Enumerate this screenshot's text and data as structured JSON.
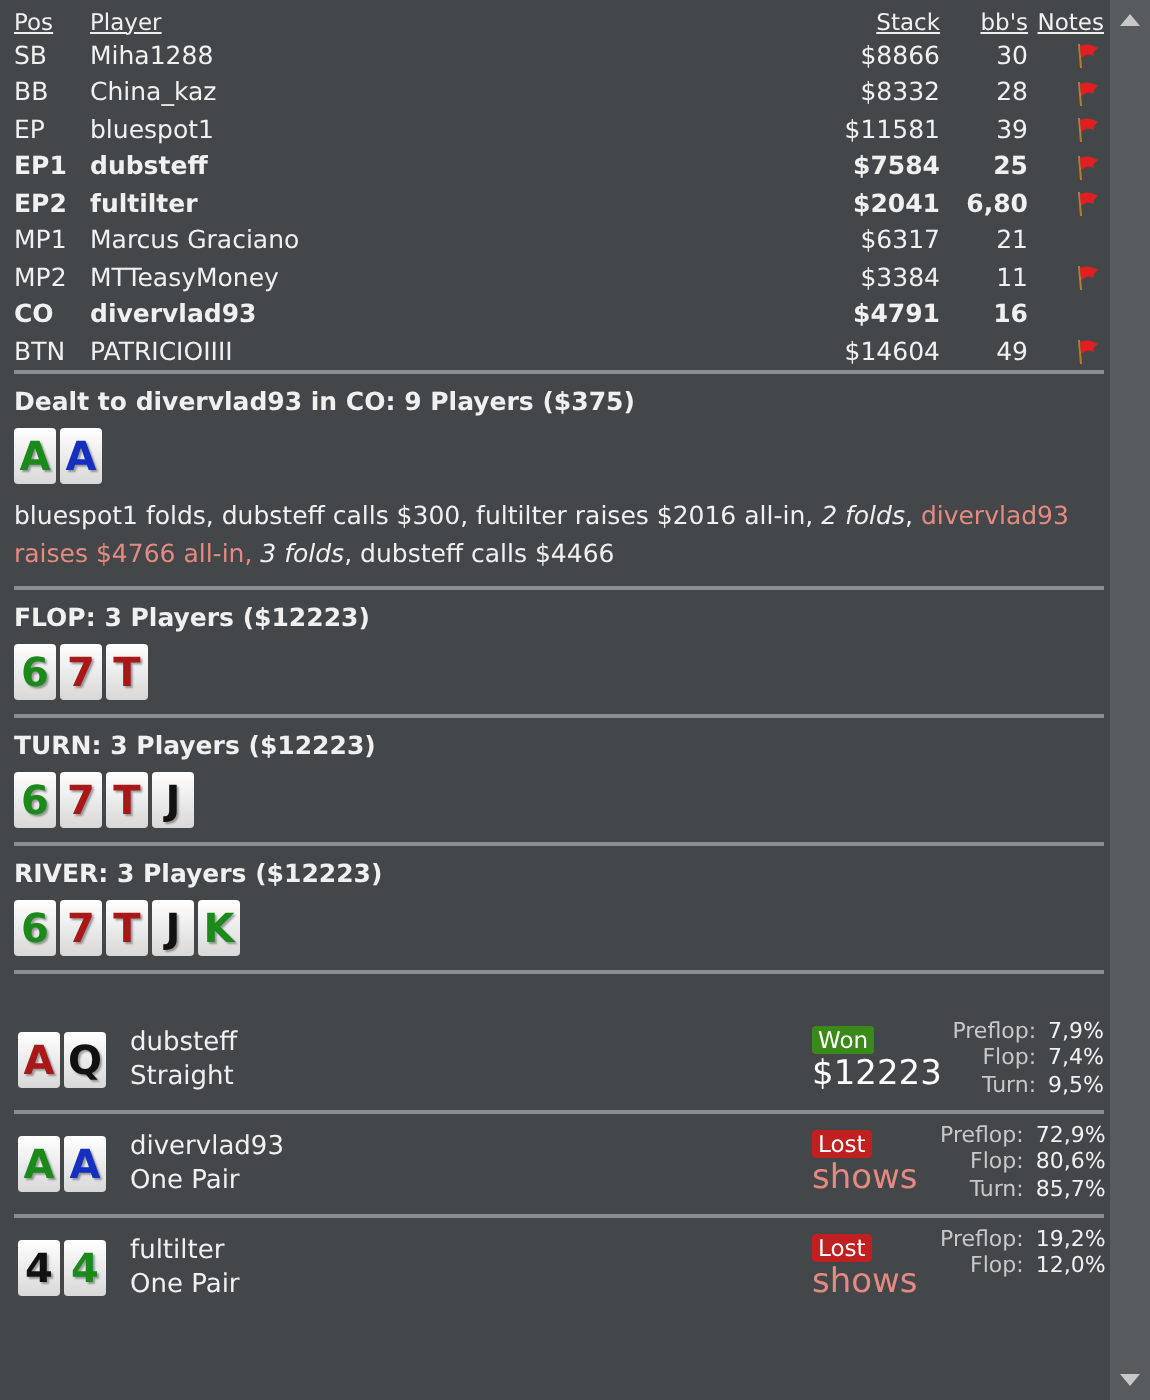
{
  "players": {
    "columns": [
      "Pos",
      "Player",
      "Stack",
      "bb's",
      "Notes"
    ],
    "rows": [
      {
        "pos": "SB",
        "player": "Miha1288",
        "stack": "$8866",
        "bbs": "30",
        "note": true,
        "highlighted": false
      },
      {
        "pos": "BB",
        "player": "China_kaz",
        "stack": "$8332",
        "bbs": "28",
        "note": true,
        "highlighted": false
      },
      {
        "pos": "EP",
        "player": "bluespot1",
        "stack": "$11581",
        "bbs": "39",
        "note": true,
        "highlighted": false
      },
      {
        "pos": "EP1",
        "player": "dubsteff",
        "stack": "$7584",
        "bbs": "25",
        "note": true,
        "highlighted": true
      },
      {
        "pos": "EP2",
        "player": "fultilter",
        "stack": "$2041",
        "bbs": "6,80",
        "note": true,
        "highlighted": true
      },
      {
        "pos": "MP1",
        "player": "Marcus Graciano",
        "stack": "$6317",
        "bbs": "21",
        "note": false,
        "highlighted": false
      },
      {
        "pos": "MP2",
        "player": "MTTeasyMoney",
        "stack": "$3384",
        "bbs": "11",
        "note": true,
        "highlighted": false
      },
      {
        "pos": "CO",
        "player": "divervlad93",
        "stack": "$4791",
        "bbs": "16",
        "note": false,
        "highlighted": true
      },
      {
        "pos": "BTN",
        "player": "PATRICIOIIII",
        "stack": "$14604",
        "bbs": "49",
        "note": true,
        "highlighted": false
      }
    ]
  },
  "streets": [
    {
      "title": "Dealt to divervlad93 in CO: 9 Players ($375)",
      "cards": [
        {
          "rank": "A",
          "color": "#1a8a1a"
        },
        {
          "rank": "A",
          "color": "#1530c0"
        }
      ],
      "actions": [
        {
          "kind": "plain",
          "text": "bluespot1 folds, dubsteff calls $300, fultilter raises $2016 all-in, "
        },
        {
          "kind": "italic",
          "text": "2 folds"
        },
        {
          "kind": "plain",
          "text": ", "
        },
        {
          "kind": "hero",
          "text": "divervlad93 raises $4766 all-in, "
        },
        {
          "kind": "italic",
          "text": "3 folds"
        },
        {
          "kind": "plain",
          "text": ", dubsteff calls $4466"
        }
      ]
    },
    {
      "title": "FLOP: 3 Players ($12223)",
      "cards": [
        {
          "rank": "6",
          "color": "#1a8a1a"
        },
        {
          "rank": "7",
          "color": "#a81818"
        },
        {
          "rank": "T",
          "color": "#a81818"
        }
      ]
    },
    {
      "title": "TURN: 3 Players ($12223)",
      "cards": [
        {
          "rank": "6",
          "color": "#1a8a1a"
        },
        {
          "rank": "7",
          "color": "#a81818"
        },
        {
          "rank": "T",
          "color": "#a81818"
        },
        {
          "rank": "J",
          "color": "#111111"
        }
      ]
    },
    {
      "title": "RIVER: 3 Players ($12223)",
      "cards": [
        {
          "rank": "6",
          "color": "#1a8a1a"
        },
        {
          "rank": "7",
          "color": "#a81818"
        },
        {
          "rank": "T",
          "color": "#a81818"
        },
        {
          "rank": "J",
          "color": "#111111"
        },
        {
          "rank": "K",
          "color": "#1a8a1a"
        }
      ]
    }
  ],
  "results": [
    {
      "cards": [
        {
          "rank": "A",
          "color": "#a81818"
        },
        {
          "rank": "Q",
          "color": "#111111"
        }
      ],
      "player": "dubsteff",
      "hand": "Straight",
      "kind": "won",
      "badge": "Won",
      "amount": "$12223",
      "equity": [
        {
          "label": "Preflop:",
          "value": "7,9%"
        },
        {
          "label": "Flop:",
          "value": "7,4%"
        },
        {
          "label": "Turn:",
          "value": "9,5%"
        }
      ]
    },
    {
      "cards": [
        {
          "rank": "A",
          "color": "#1a8a1a"
        },
        {
          "rank": "A",
          "color": "#1530c0"
        }
      ],
      "player": "divervlad93",
      "hand": "One Pair",
      "kind": "lost",
      "badge": "Lost",
      "amount": "shows",
      "equity": [
        {
          "label": "Preflop:",
          "value": "72,9%"
        },
        {
          "label": "Flop:",
          "value": "80,6%"
        },
        {
          "label": "Turn:",
          "value": "85,7%"
        }
      ]
    },
    {
      "cards": [
        {
          "rank": "4",
          "color": "#111111"
        },
        {
          "rank": "4",
          "color": "#1a8a1a"
        }
      ],
      "player": "fultilter",
      "hand": "One Pair",
      "kind": "lost",
      "badge": "Lost",
      "amount": "shows",
      "equity": [
        {
          "label": "Preflop:",
          "value": "19,2%"
        },
        {
          "label": "Flop:",
          "value": "12,0%"
        }
      ]
    }
  ]
}
